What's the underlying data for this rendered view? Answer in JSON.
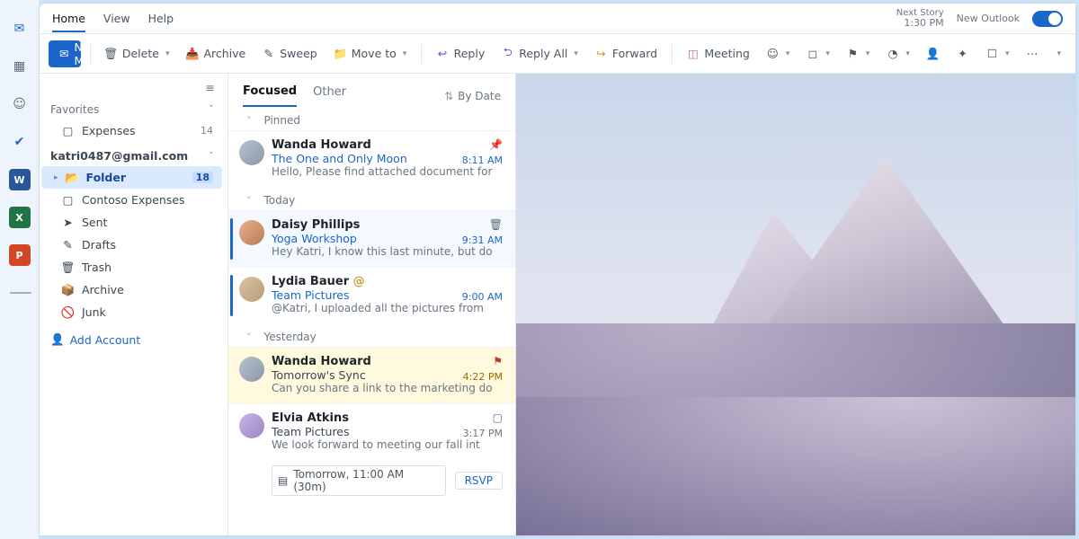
{
  "tabs": {
    "home": "Home",
    "view": "View",
    "help": "Help"
  },
  "header_right": {
    "status_label": "Next Story",
    "status_time": "1:30 PM",
    "new_outlook": "New Outlook"
  },
  "ribbon": {
    "new_mail": "New Mail",
    "delete": "Delete",
    "archive": "Archive",
    "sweep": "Sweep",
    "move_to": "Move to",
    "reply": "Reply",
    "reply_all": "Reply All",
    "forward": "Forward",
    "meeting": "Meeting"
  },
  "folders": {
    "favorites_label": "Favorites",
    "expenses": "Expenses",
    "expenses_count": "14",
    "account": "katri0487@gmail.com",
    "folder": "Folder",
    "folder_count": "18",
    "contoso": "Contoso Expenses",
    "sent": "Sent",
    "drafts": "Drafts",
    "trash": "Trash",
    "archive": "Archive",
    "junk": "Junk",
    "add_account": "Add Account"
  },
  "list": {
    "focused": "Focused",
    "other": "Other",
    "sort": "By Date",
    "grp_pinned": "Pinned",
    "grp_today": "Today",
    "grp_yesterday": "Yesterday",
    "m1": {
      "from": "Wanda Howard",
      "subj": "The One and Only Moon",
      "time": "8:11 AM",
      "prev": "Hello, Please find attached document for"
    },
    "m2": {
      "from": "Daisy Phillips",
      "subj": "Yoga Workshop",
      "time": "9:31 AM",
      "prev": "Hey Katri, I know this last minute, but do"
    },
    "m3": {
      "from": "Lydia Bauer",
      "subj": "Team Pictures",
      "time": "9:00 AM",
      "prev": "@Katri, I uploaded all the pictures from"
    },
    "m4": {
      "from": "Wanda Howard",
      "subj": "Tomorrow's Sync",
      "time": "4:22 PM",
      "prev": "Can you share a link to the marketing do"
    },
    "m5": {
      "from": "Elvia Atkins",
      "subj": "Team Pictures",
      "time": "3:17 PM",
      "prev": "We look forward to meeting our fall int"
    },
    "meeting_slot": "Tomorrow, 11:00 AM (30m)",
    "rsvp": "RSVP"
  }
}
